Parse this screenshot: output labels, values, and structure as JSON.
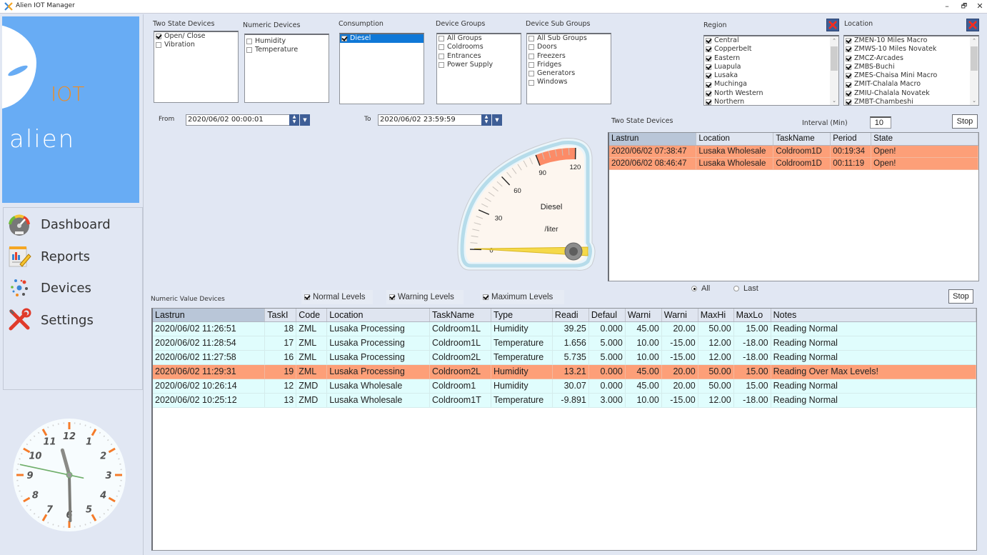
{
  "window": {
    "title": "Alien IOT Manager",
    "controls": {
      "minimize": "–",
      "maximize": "🗗",
      "close": "✕"
    }
  },
  "logo": {
    "product": "IOT",
    "brand": "alien"
  },
  "sidebar": {
    "items": [
      {
        "label": "Dashboard",
        "icon": "dashboard-gauge-icon"
      },
      {
        "label": "Reports",
        "icon": "reports-icon"
      },
      {
        "label": "Devices",
        "icon": "devices-network-icon"
      },
      {
        "label": "Settings",
        "icon": "settings-tools-icon"
      }
    ]
  },
  "clock": {
    "numbers": [
      "12",
      "1",
      "2",
      "3",
      "4",
      "5",
      "6",
      "7",
      "8",
      "9",
      "10",
      "11"
    ],
    "hour": 11,
    "minute": 29,
    "second": 47
  },
  "filters": {
    "two_state": {
      "label": "Two State Devices",
      "items": [
        {
          "label": "Open/ Close",
          "checked": true
        },
        {
          "label": "Vibration",
          "checked": false
        }
      ]
    },
    "numeric": {
      "label": "Numeric Devices",
      "items": [
        {
          "label": "Humidity",
          "checked": false
        },
        {
          "label": "Temperature",
          "checked": false
        }
      ]
    },
    "consumption": {
      "label": "Consumption",
      "items": [
        {
          "label": "Diesel",
          "checked": true,
          "selected": true
        }
      ]
    },
    "device_groups": {
      "label": "Device Groups",
      "items": [
        {
          "label": "All Groups",
          "checked": false
        },
        {
          "label": "Coldrooms",
          "checked": false
        },
        {
          "label": "Entrances",
          "checked": false
        },
        {
          "label": "Power Supply",
          "checked": false
        }
      ]
    },
    "device_sub_groups": {
      "label": "Device Sub Groups",
      "items": [
        {
          "label": "All Sub Groups",
          "checked": false
        },
        {
          "label": "Doors",
          "checked": false
        },
        {
          "label": "Freezers",
          "checked": false
        },
        {
          "label": "Fridges",
          "checked": false
        },
        {
          "label": "Generators",
          "checked": false
        },
        {
          "label": "Windows",
          "checked": false
        }
      ]
    },
    "region": {
      "label": "Region",
      "items": [
        {
          "label": "Central",
          "checked": true
        },
        {
          "label": "Copperbelt",
          "checked": true
        },
        {
          "label": "Eastern",
          "checked": true
        },
        {
          "label": "Luapula",
          "checked": true
        },
        {
          "label": "Lusaka",
          "checked": true
        },
        {
          "label": "Muchinga",
          "checked": true
        },
        {
          "label": "North Western",
          "checked": true
        },
        {
          "label": "Northern",
          "checked": true
        }
      ]
    },
    "location": {
      "label": "Location",
      "items": [
        {
          "label": "ZMEN-10 Miles Macro",
          "checked": true
        },
        {
          "label": "ZMWS-10 Miles Novatek",
          "checked": true
        },
        {
          "label": "ZMCZ-Arcades",
          "checked": true
        },
        {
          "label": "ZMBS-Buchi",
          "checked": true
        },
        {
          "label": "ZMES-Chaisa Mini Macro",
          "checked": true
        },
        {
          "label": "ZMIT-Chalala Macro",
          "checked": true
        },
        {
          "label": "ZMIU-Chalala Novatek",
          "checked": true
        },
        {
          "label": "ZMBT-Chambeshi",
          "checked": true
        }
      ]
    }
  },
  "date_range": {
    "from_label": "From",
    "from_value": "2020/06/02 00:00:01",
    "to_label": "To",
    "to_value": "2020/06/02 23:59:59"
  },
  "gauge": {
    "title": "Diesel",
    "unit": "/liter",
    "min": 0,
    "max": 120,
    "ticks": [
      "0",
      "30",
      "60",
      "90",
      "120"
    ],
    "warning_range": [
      90,
      120
    ],
    "value": 0,
    "colors": {
      "warning": "#fc8b67",
      "needle": "#f5d94a",
      "frame": "#b6dcea"
    }
  },
  "two_state_panel": {
    "label": "Two State Devices",
    "interval_label": "Interval (Min)",
    "interval_value": "10",
    "stop_label": "Stop",
    "columns": [
      "Lastrun",
      "Location",
      "TaskName",
      "Period",
      "State"
    ],
    "rows": [
      {
        "status": "alert",
        "cells": [
          "2020/06/02 07:38:47",
          "Lusaka Wholesale",
          "Coldroom1D",
          "00:19:34",
          "Open!"
        ]
      },
      {
        "status": "alert",
        "cells": [
          "2020/06/02 08:46:47",
          "Lusaka Wholesale",
          "Coldroom1D",
          "00:11:19",
          "Open!"
        ]
      }
    ],
    "radio_all": "All",
    "radio_last": "Last",
    "radio_selected": "All"
  },
  "numeric_panel": {
    "label": "Numeric Value Devices",
    "filters": [
      {
        "label": "Normal Levels",
        "checked": true
      },
      {
        "label": "Warning Levels",
        "checked": true
      },
      {
        "label": "Maximum Levels",
        "checked": true
      }
    ],
    "stop_label": "Stop",
    "columns": [
      "Lastrun",
      "TaskI",
      "Code",
      "Location",
      "TaskName",
      "Type",
      "Readi",
      "Defaul",
      "Warni",
      "Warni",
      "MaxHi",
      "MaxLo",
      "Notes"
    ],
    "rows": [
      {
        "status": "normal",
        "cells": [
          "2020/06/02 11:26:51",
          "18",
          "ZML",
          "Lusaka Processing",
          "Coldroom1L",
          "Humidity",
          "39.25",
          "0.000",
          "45.00",
          "20.00",
          "50.00",
          "15.00",
          "Reading Normal"
        ]
      },
      {
        "status": "normal",
        "cells": [
          "2020/06/02 11:28:54",
          "17",
          "ZML",
          "Lusaka Processing",
          "Coldroom1L",
          "Temperature",
          "1.656",
          "5.000",
          "10.00",
          "-15.00",
          "12.00",
          "-18.00",
          "Reading Normal"
        ]
      },
      {
        "status": "normal",
        "cells": [
          "2020/06/02 11:27:58",
          "16",
          "ZML",
          "Lusaka Processing",
          "Coldroom2L",
          "Temperature",
          "5.735",
          "5.000",
          "10.00",
          "-15.00",
          "12.00",
          "-18.00",
          "Reading Normal"
        ]
      },
      {
        "status": "alert",
        "cells": [
          "2020/06/02 11:29:31",
          "19",
          "ZML",
          "Lusaka Processing",
          "Coldroom2L",
          "Humidity",
          "13.21",
          "0.000",
          "45.00",
          "20.00",
          "50.00",
          "15.00",
          "Reading Over Max Levels!"
        ]
      },
      {
        "status": "normal",
        "cells": [
          "2020/06/02 10:26:14",
          "12",
          "ZMD",
          "Lusaka Wholesale",
          "Coldroom1",
          "Humidity",
          "30.07",
          "0.000",
          "45.00",
          "20.00",
          "50.00",
          "15.00",
          "Reading Normal"
        ]
      },
      {
        "status": "normal",
        "cells": [
          "2020/06/02 10:25:12",
          "13",
          "ZMD",
          "Lusaka Wholesale",
          "Coldroom1T",
          "Temperature",
          "-9.891",
          "3.000",
          "10.00",
          "-15.00",
          "12.00",
          "-18.00",
          "Reading Normal"
        ]
      }
    ]
  },
  "colors": {
    "logo_bg": "#68acf4",
    "alert_row": "#fd9f78",
    "normal_row": "#e0fdfd",
    "selection": "#0f78d7",
    "spinner": "#3e5e96"
  }
}
